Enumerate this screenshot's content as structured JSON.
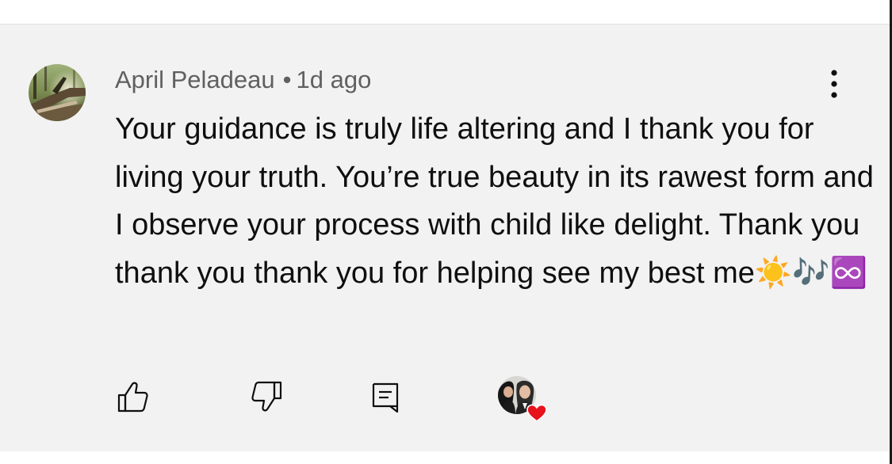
{
  "comment": {
    "author": "April Peladeau",
    "separator": "•",
    "timestamp": "1d ago",
    "text": "Your guidance is truly life altering and I thank you for living your truth. You’re true beauty in its rawest form and I observe your process with child like delight. Thank you thank you thank you for helping see my best me☀️🎶♾️"
  },
  "actions": {
    "like_icon": "thumbs-up-icon",
    "dislike_icon": "thumbs-down-icon",
    "reply_icon": "reply-comment-icon",
    "creator_heart_icon": "creator-heart-icon",
    "menu_icon": "more-vert-icon"
  },
  "colors": {
    "card_background": "#f2f2f2",
    "text": "#0f0f0f",
    "meta_text": "#606060",
    "heart": "#e8121c"
  }
}
